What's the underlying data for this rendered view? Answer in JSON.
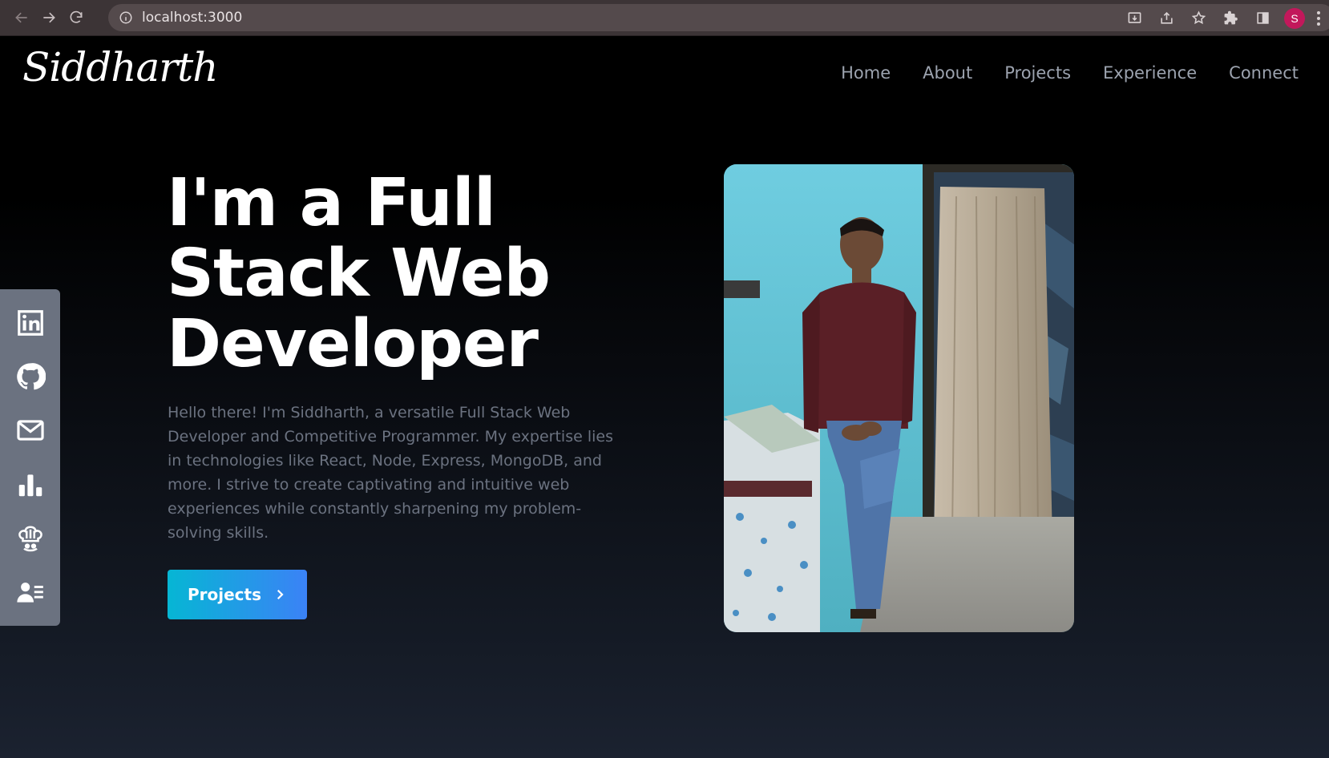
{
  "browser": {
    "url": "localhost:3000",
    "profile_initial": "S"
  },
  "header": {
    "logo": "Siddharth",
    "nav": [
      "Home",
      "About",
      "Projects",
      "Experience",
      "Connect"
    ]
  },
  "hero": {
    "title": "I'm a Full Stack Web Developer",
    "description": "Hello there! I'm Siddharth, a versatile Full Stack Web Developer and Competitive Programmer. My expertise lies in technologies like React, Node, Express, MongoDB, and more. I strive to create captivating and intuitive web experiences while constantly sharpening my problem-solving skills.",
    "cta_label": "Projects"
  },
  "social": {
    "icons": [
      "linkedin-icon",
      "github-icon",
      "mail-icon",
      "bar-chart-icon",
      "chef-hat-icon",
      "resume-icon"
    ]
  },
  "colors": {
    "accent_start": "#06b6d4",
    "accent_end": "#3b82f6",
    "sidebar": "#6b7280",
    "nav_text": "#9ca3af"
  }
}
